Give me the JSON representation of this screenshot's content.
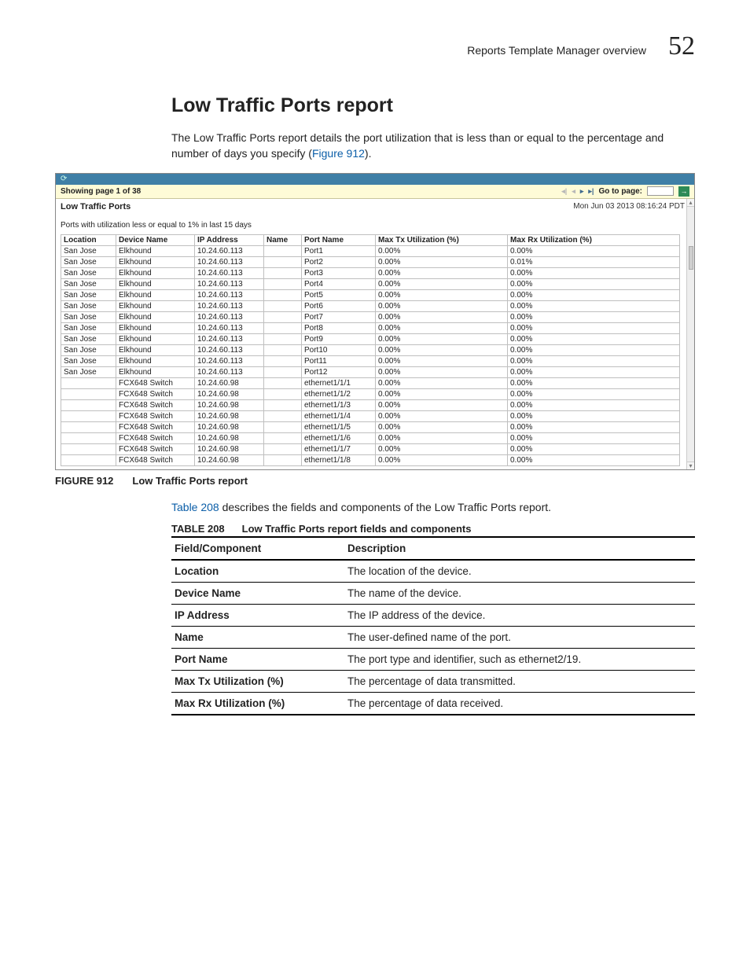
{
  "header": {
    "overview": "Reports Template Manager overview",
    "page_num": "52"
  },
  "section": {
    "title": "Low Traffic Ports report",
    "intro_a": "The Low Traffic Ports report details the port utilization that is less than or equal to the percentage and number of days you specify (",
    "intro_link": "Figure 912",
    "intro_b": ")."
  },
  "shot": {
    "pager_text": "Showing page  1  of  38",
    "go_label": "Go to page:",
    "title": "Low Traffic Ports",
    "timestamp": "Mon Jun 03 2013 08:16:24 PDT",
    "subtitle": "Ports with utilization less or equal to 1% in last 15 days",
    "columns": [
      "Location",
      "Device Name",
      "IP Address",
      "Name",
      "Port Name",
      "Max Tx Utilization (%)",
      "Max Rx Utilization (%)"
    ],
    "rows": [
      [
        "San Jose",
        "Elkhound",
        "10.24.60.113",
        "",
        "Port1",
        "0.00%",
        "0.00%"
      ],
      [
        "San Jose",
        "Elkhound",
        "10.24.60.113",
        "",
        "Port2",
        "0.00%",
        "0.01%"
      ],
      [
        "San Jose",
        "Elkhound",
        "10.24.60.113",
        "",
        "Port3",
        "0.00%",
        "0.00%"
      ],
      [
        "San Jose",
        "Elkhound",
        "10.24.60.113",
        "",
        "Port4",
        "0.00%",
        "0.00%"
      ],
      [
        "San Jose",
        "Elkhound",
        "10.24.60.113",
        "",
        "Port5",
        "0.00%",
        "0.00%"
      ],
      [
        "San Jose",
        "Elkhound",
        "10.24.60.113",
        "",
        "Port6",
        "0.00%",
        "0.00%"
      ],
      [
        "San Jose",
        "Elkhound",
        "10.24.60.113",
        "",
        "Port7",
        "0.00%",
        "0.00%"
      ],
      [
        "San Jose",
        "Elkhound",
        "10.24.60.113",
        "",
        "Port8",
        "0.00%",
        "0.00%"
      ],
      [
        "San Jose",
        "Elkhound",
        "10.24.60.113",
        "",
        "Port9",
        "0.00%",
        "0.00%"
      ],
      [
        "San Jose",
        "Elkhound",
        "10.24.60.113",
        "",
        "Port10",
        "0.00%",
        "0.00%"
      ],
      [
        "San Jose",
        "Elkhound",
        "10.24.60.113",
        "",
        "Port11",
        "0.00%",
        "0.00%"
      ],
      [
        "San Jose",
        "Elkhound",
        "10.24.60.113",
        "",
        "Port12",
        "0.00%",
        "0.00%"
      ],
      [
        "",
        "FCX648 Switch",
        "10.24.60.98",
        "",
        "ethernet1/1/1",
        "0.00%",
        "0.00%"
      ],
      [
        "",
        "FCX648 Switch",
        "10.24.60.98",
        "",
        "ethernet1/1/2",
        "0.00%",
        "0.00%"
      ],
      [
        "",
        "FCX648 Switch",
        "10.24.60.98",
        "",
        "ethernet1/1/3",
        "0.00%",
        "0.00%"
      ],
      [
        "",
        "FCX648 Switch",
        "10.24.60.98",
        "",
        "ethernet1/1/4",
        "0.00%",
        "0.00%"
      ],
      [
        "",
        "FCX648 Switch",
        "10.24.60.98",
        "",
        "ethernet1/1/5",
        "0.00%",
        "0.00%"
      ],
      [
        "",
        "FCX648 Switch",
        "10.24.60.98",
        "",
        "ethernet1/1/6",
        "0.00%",
        "0.00%"
      ],
      [
        "",
        "FCX648 Switch",
        "10.24.60.98",
        "",
        "ethernet1/1/7",
        "0.00%",
        "0.00%"
      ],
      [
        "",
        "FCX648 Switch",
        "10.24.60.98",
        "",
        "ethernet1/1/8",
        "0.00%",
        "0.00%"
      ]
    ]
  },
  "figure": {
    "label": "FIGURE 912",
    "text": "Low Traffic Ports report"
  },
  "para2_a": "",
  "para2_link": "Table 208",
  "para2_b": " describes the fields and components of the Low Traffic Ports report.",
  "table_caption": {
    "label": "TABLE 208",
    "text": "Low Traffic Ports report fields and components"
  },
  "desc_table": {
    "headers": [
      "Field/Component",
      "Description"
    ],
    "rows": [
      [
        "Location",
        "The location of the device."
      ],
      [
        "Device Name",
        "The name of the device."
      ],
      [
        "IP Address",
        "The IP address of the device."
      ],
      [
        "Name",
        "The user-defined name of the port."
      ],
      [
        "Port Name",
        "The port type and identifier, such as ethernet2/19."
      ],
      [
        "Max Tx Utilization (%)",
        "The percentage of data transmitted."
      ],
      [
        "Max Rx Utilization (%)",
        "The percentage of data received."
      ]
    ]
  }
}
